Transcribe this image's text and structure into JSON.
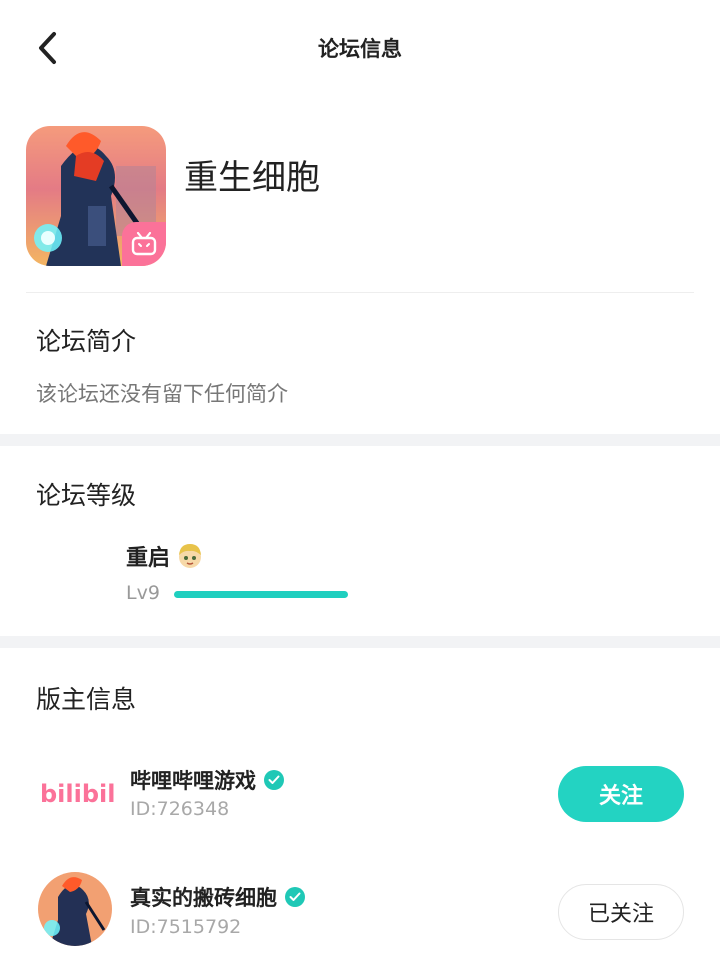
{
  "header": {
    "title": "论坛信息",
    "back_icon": "chevron-left-icon"
  },
  "forum": {
    "name": "重生细胞",
    "badge_icon": "bilibili-tv-icon"
  },
  "intro": {
    "title": "论坛简介",
    "text": "该论坛还没有留下任何简介"
  },
  "level": {
    "title": "论坛等级",
    "rank_name": "重启",
    "lv_label": "Lv9",
    "progress": 1.0
  },
  "moderators": {
    "title": "版主信息",
    "items": [
      {
        "logo_text": "bilibili",
        "name": "哔哩哔哩游戏",
        "id": "ID:726348",
        "button": "关注",
        "followed": false
      },
      {
        "name": "真实的搬砖细胞",
        "id": "ID:7515792",
        "button": "已关注",
        "followed": true
      }
    ]
  },
  "colors": {
    "accent": "#23d3c2",
    "bilibili_pink": "#fb7299"
  }
}
